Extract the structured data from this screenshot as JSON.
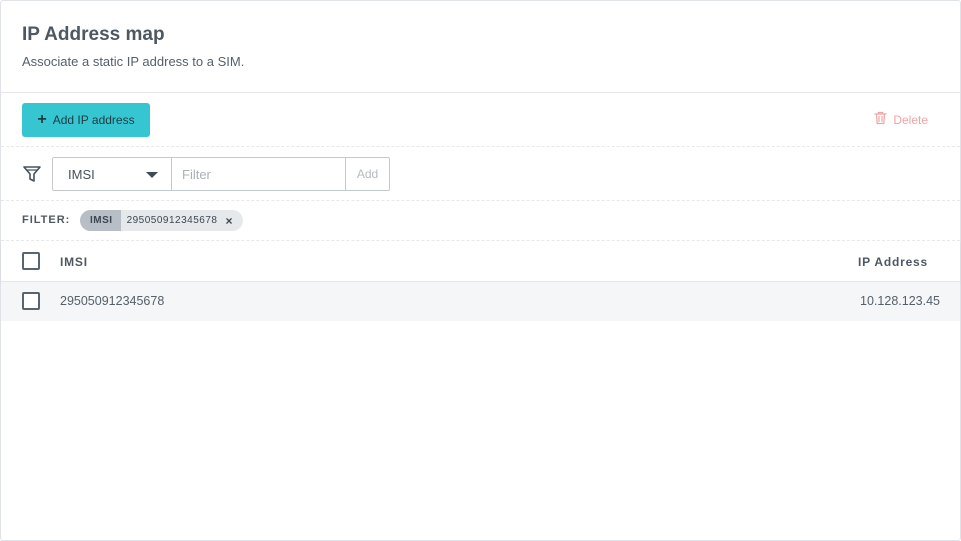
{
  "header": {
    "title": "IP Address map",
    "subtitle": "Associate a static IP address to a SIM."
  },
  "toolbar": {
    "add_label": "Add IP address",
    "delete_label": "Delete"
  },
  "filter": {
    "select_value": "IMSI",
    "input_placeholder": "Filter",
    "add_label": "Add"
  },
  "active_filter": {
    "label": "FILTER:",
    "chip_key": "IMSI",
    "chip_value": "295050912345678",
    "remove_symbol": "×"
  },
  "table": {
    "columns": [
      "IMSI",
      "IP Address"
    ],
    "rows": [
      {
        "imsi": "295050912345678",
        "ip": "10.128.123.45"
      }
    ]
  },
  "colors": {
    "accent": "#35c6d2",
    "danger_muted": "#f1a3a3"
  }
}
